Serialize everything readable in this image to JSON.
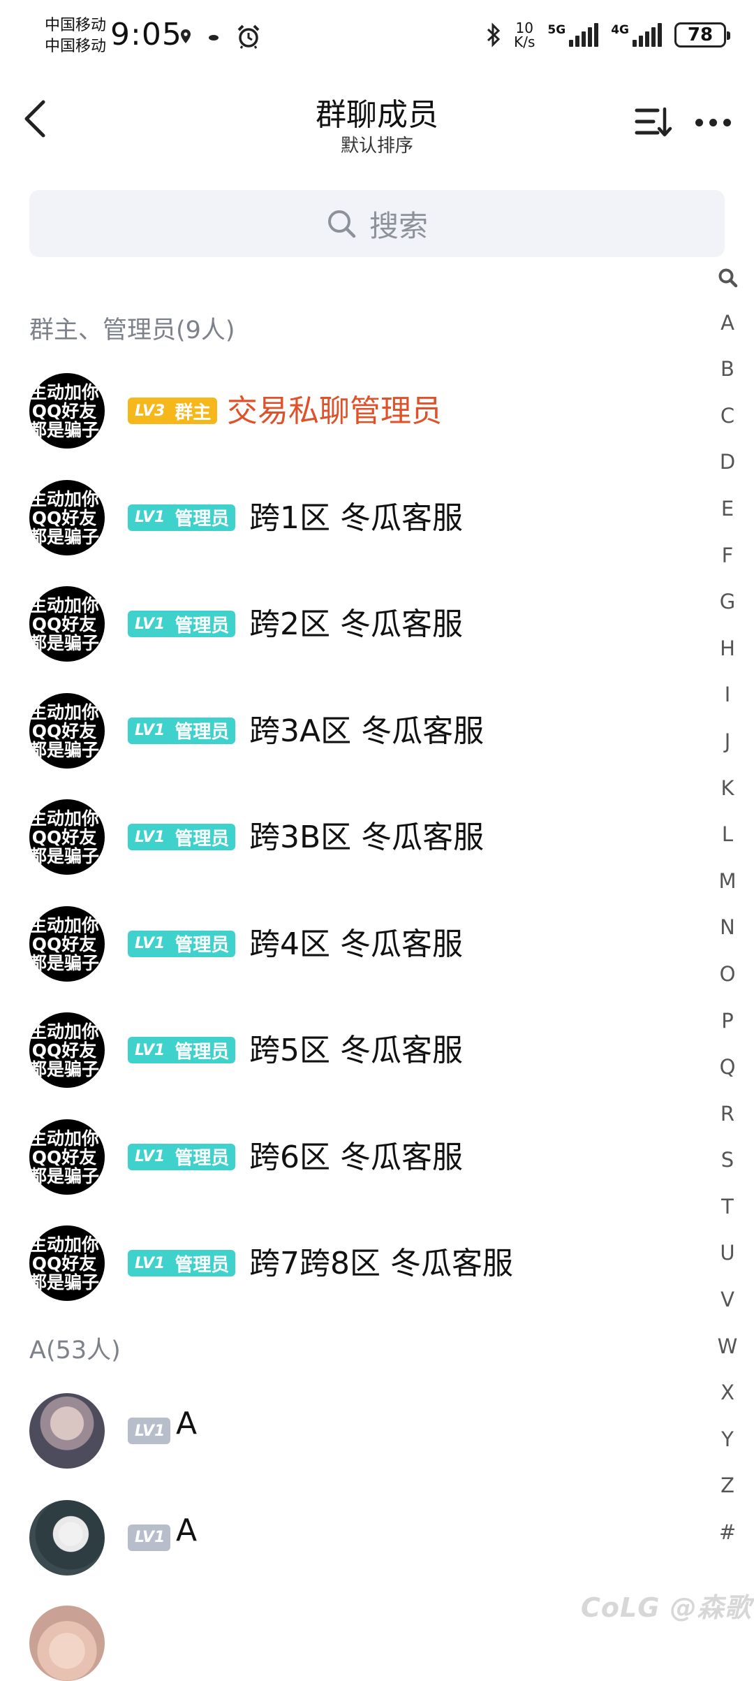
{
  "status_bar": {
    "carrier_1": "中国移动",
    "carrier_2": "中国移动",
    "time": "9:05",
    "net_speed_value": "10",
    "net_speed_unit": "K/s",
    "signal_1_tag": "5G",
    "signal_2_tag": "4G",
    "battery": "78"
  },
  "header": {
    "title": "群聊成员",
    "subtitle": "默认排序"
  },
  "search": {
    "placeholder": "搜索"
  },
  "index_letters": [
    "A",
    "B",
    "C",
    "D",
    "E",
    "F",
    "G",
    "H",
    "I",
    "J",
    "K",
    "L",
    "M",
    "N",
    "O",
    "P",
    "Q",
    "R",
    "S",
    "T",
    "U",
    "V",
    "W",
    "X",
    "Y",
    "Z",
    "#"
  ],
  "sections": {
    "admins": {
      "title": "群主、管理员(9人)",
      "members": [
        {
          "avatar_text": [
            "主动加你",
            "QQ好友",
            "都是骗子"
          ],
          "level": "LV3",
          "role": "群主",
          "name": "交易私聊管理员"
        },
        {
          "avatar_text": [
            "主动加你",
            "QQ好友",
            "都是骗子"
          ],
          "level": "LV1",
          "role": "管理员",
          "name": "跨1区 冬瓜客服"
        },
        {
          "avatar_text": [
            "主动加你",
            "QQ好友",
            "都是骗子"
          ],
          "level": "LV1",
          "role": "管理员",
          "name": "跨2区 冬瓜客服"
        },
        {
          "avatar_text": [
            "主动加你",
            "QQ好友",
            "都是骗子"
          ],
          "level": "LV1",
          "role": "管理员",
          "name": "跨3A区 冬瓜客服"
        },
        {
          "avatar_text": [
            "主动加你",
            "QQ好友",
            "都是骗子"
          ],
          "level": "LV1",
          "role": "管理员",
          "name": "跨3B区 冬瓜客服"
        },
        {
          "avatar_text": [
            "主动加你",
            "QQ好友",
            "都是骗子"
          ],
          "level": "LV1",
          "role": "管理员",
          "name": "跨4区 冬瓜客服"
        },
        {
          "avatar_text": [
            "主动加你",
            "QQ好友",
            "都是骗子"
          ],
          "level": "LV1",
          "role": "管理员",
          "name": "跨5区 冬瓜客服"
        },
        {
          "avatar_text": [
            "主动加你",
            "QQ好友",
            "都是骗子"
          ],
          "level": "LV1",
          "role": "管理员",
          "name": "跨6区 冬瓜客服"
        },
        {
          "avatar_text": [
            "主动加你",
            "QQ好友",
            "都是骗子"
          ],
          "level": "LV1",
          "role": "管理员",
          "name": "跨7跨8区 冬瓜客服"
        }
      ]
    },
    "a": {
      "title": "A(53人)",
      "members": [
        {
          "level": "LV1",
          "name": "A"
        },
        {
          "level": "LV1",
          "name": "A"
        }
      ]
    }
  },
  "watermark": "CoLG @森歌"
}
